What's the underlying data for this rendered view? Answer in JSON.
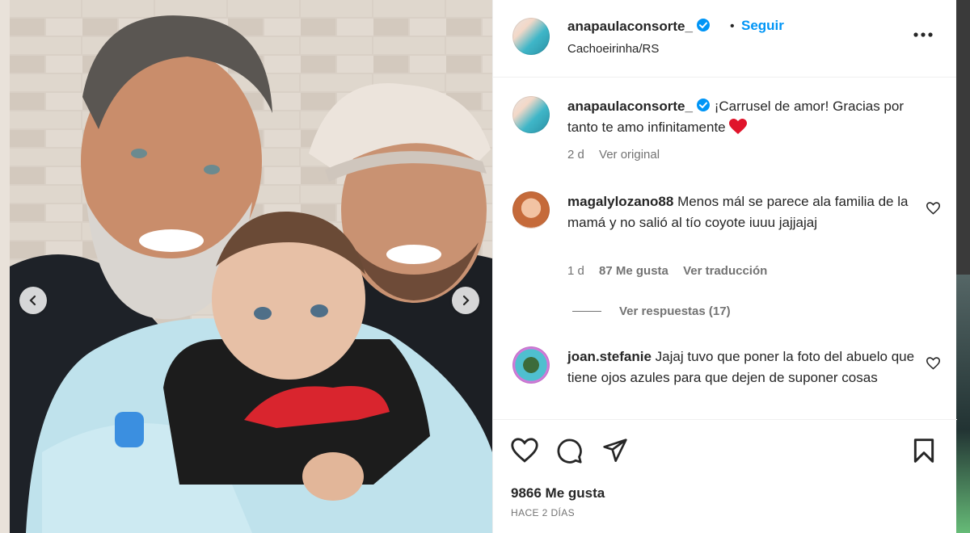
{
  "post": {
    "author": "anapaulaconsorte_",
    "separator": "•",
    "follow_label": "Seguir",
    "location": "Cachoeirinha/RS",
    "caption": {
      "username": "anapaulaconsorte_",
      "text": "¡Carrusel de amor! Gracias por tanto te amo infinitamente",
      "age": "2 d",
      "see_original": "Ver original"
    },
    "comments": [
      {
        "username": "magalylozano88",
        "text": "Menos mál se parece ala familia de la mamá y no salió al tío coyote iuuu jajjajaj",
        "age": "1 d",
        "likes": "87 Me gusta",
        "translate": "Ver traducción",
        "replies": "Ver respuestas (17)"
      },
      {
        "username": "joan.stefanie",
        "text": "Jajaj tuvo que poner la foto del abuelo que tiene ojos azules para que dejen de suponer cosas"
      }
    ],
    "like_count": "9866 Me gusta",
    "posted": "HACE 2 DÍAS"
  },
  "colors": {
    "link": "#0095f6",
    "text": "#262626",
    "secondary": "#737373",
    "heart_emoji": "#e0142b"
  },
  "icons": [
    "verified-badge-icon",
    "more-icon",
    "heart-icon",
    "comment-icon",
    "share-icon",
    "save-icon",
    "chevron-left-icon",
    "chevron-right-icon"
  ]
}
